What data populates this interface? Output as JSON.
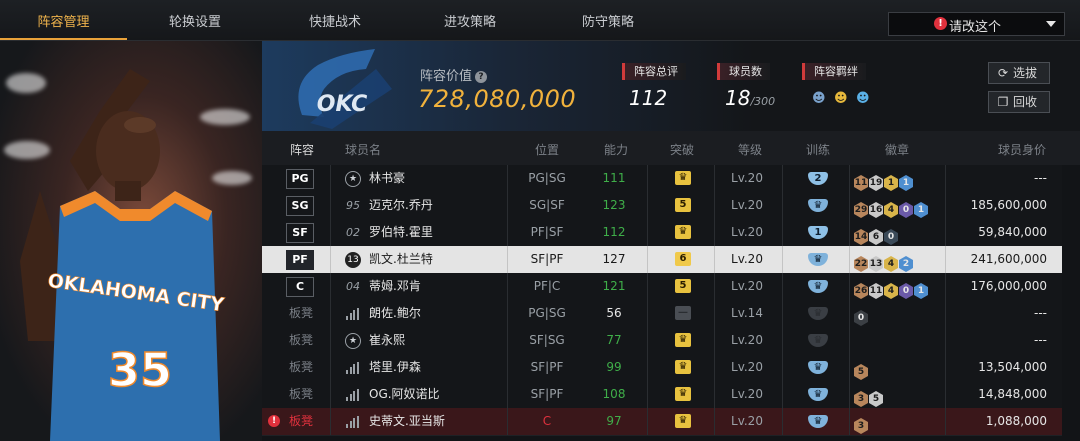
{
  "nav": {
    "tabs": [
      {
        "label": "阵容管理",
        "active": true
      },
      {
        "label": "轮换设置",
        "active": false
      },
      {
        "label": "快捷战术",
        "active": false
      },
      {
        "label": "进攻策略",
        "active": false
      },
      {
        "label": "防守策略",
        "active": false
      }
    ],
    "dropdown_label": "请改这个"
  },
  "team": {
    "logo_text": "OKC",
    "value_label": "阵容价值",
    "value": "728,080,000",
    "rating_label": "阵容总评",
    "rating": "112",
    "roster_label": "球员数",
    "roster_count": "18",
    "roster_max": "/300",
    "chemistry_label": "阵容羁绊",
    "filter_button": "选拔",
    "recall_button": "回收"
  },
  "player_image": {
    "team_text": "OKLAHOMA CITY",
    "number": "35"
  },
  "columns": [
    "阵容",
    "球员名",
    "位置",
    "能力",
    "突破",
    "等级",
    "训练",
    "徽章",
    "球员身价"
  ],
  "players": [
    {
      "slot": "PG",
      "icon": "star",
      "number": "",
      "name": "林书豪",
      "position": "PG|SG",
      "ability": "111",
      "breakthrough": "crown",
      "level": "Lv.20",
      "training": "2",
      "badges": [
        [
          "11",
          "#b8865c"
        ],
        [
          "19",
          "#c9c9c9"
        ],
        [
          "1",
          "#d8b44a"
        ],
        [
          "1",
          "#4f8fd0"
        ]
      ],
      "price": "---"
    },
    {
      "slot": "SG",
      "icon": "none",
      "number": "95",
      "name": "迈克尔.乔丹",
      "position": "SG|SF",
      "ability": "123",
      "breakthrough": "5",
      "level": "Lv.20",
      "training": "crown",
      "badges": [
        [
          "29",
          "#b8865c"
        ],
        [
          "16",
          "#c9c9c9"
        ],
        [
          "4",
          "#d8b44a"
        ],
        [
          "0",
          "#6b5aa8"
        ],
        [
          "1",
          "#4f8fd0"
        ]
      ],
      "price": "185,600,000"
    },
    {
      "slot": "SF",
      "icon": "none",
      "number": "02",
      "name": "罗伯特.霍里",
      "position": "PF|SF",
      "ability": "112",
      "breakthrough": "crown",
      "level": "Lv.20",
      "training": "1",
      "badges": [
        [
          "14",
          "#b8865c"
        ],
        [
          "6",
          "#c9c9c9"
        ],
        [
          "0",
          "#3b4a58"
        ]
      ],
      "price": "59,840,000"
    },
    {
      "slot": "PF",
      "icon": "ring",
      "number": "13",
      "name": "凯文.杜兰特",
      "position": "SF|PF",
      "ability": "127",
      "breakthrough": "6",
      "level": "Lv.20",
      "training": "crown",
      "badges": [
        [
          "22",
          "#b8865c"
        ],
        [
          "13",
          "#c9c9c9"
        ],
        [
          "4",
          "#d8b44a"
        ],
        [
          "2",
          "#4f8fd0"
        ]
      ],
      "price": "241,600,000"
    },
    {
      "slot": "C",
      "icon": "none",
      "number": "04",
      "name": "蒂姆.邓肯",
      "position": "PF|C",
      "ability": "121",
      "breakthrough": "5",
      "level": "Lv.20",
      "training": "crown",
      "badges": [
        [
          "26",
          "#b8865c"
        ],
        [
          "11",
          "#c9c9c9"
        ],
        [
          "4",
          "#d8b44a"
        ],
        [
          "0",
          "#6b5aa8"
        ],
        [
          "1",
          "#4f8fd0"
        ]
      ],
      "price": "176,000,000"
    },
    {
      "slot": "板凳",
      "icon": "bars",
      "number": "",
      "name": "朗佐.鲍尔",
      "position": "PG|SG",
      "ability": "56",
      "breakthrough": "gray",
      "level": "Lv.14",
      "training": "gray",
      "badges": [
        [
          "0",
          "#3b3f44"
        ]
      ],
      "price": "---"
    },
    {
      "slot": "板凳",
      "icon": "star",
      "number": "",
      "name": "崔永熙",
      "position": "SF|SG",
      "ability": "77",
      "breakthrough": "crown",
      "level": "Lv.20",
      "training": "gray",
      "badges": [],
      "price": "---"
    },
    {
      "slot": "板凳",
      "icon": "bars",
      "number": "",
      "name": "塔里.伊森",
      "position": "SF|PF",
      "ability": "99",
      "breakthrough": "crown",
      "level": "Lv.20",
      "training": "crown",
      "badges": [
        [
          "5",
          "#b8865c"
        ]
      ],
      "price": "13,504,000"
    },
    {
      "slot": "板凳",
      "icon": "bars",
      "number": "",
      "name": "OG.阿奴诺比",
      "position": "SF|PF",
      "ability": "108",
      "breakthrough": "crown",
      "level": "Lv.20",
      "training": "crown",
      "badges": [
        [
          "3",
          "#b8865c"
        ],
        [
          "5",
          "#c9c9c9"
        ]
      ],
      "price": "14,848,000"
    },
    {
      "slot": "板凳",
      "icon": "bars",
      "number": "",
      "name": "史蒂文.亚当斯",
      "position": "C",
      "ability": "97",
      "breakthrough": "crown",
      "level": "Lv.20",
      "training": "crown",
      "badges": [
        [
          "3",
          "#b8865c"
        ]
      ],
      "price": "1,088,000",
      "warning": true
    }
  ],
  "colors": {
    "accent": "#f1b23c",
    "ability_green": "#3fae49",
    "warn_red": "#e0313d"
  }
}
